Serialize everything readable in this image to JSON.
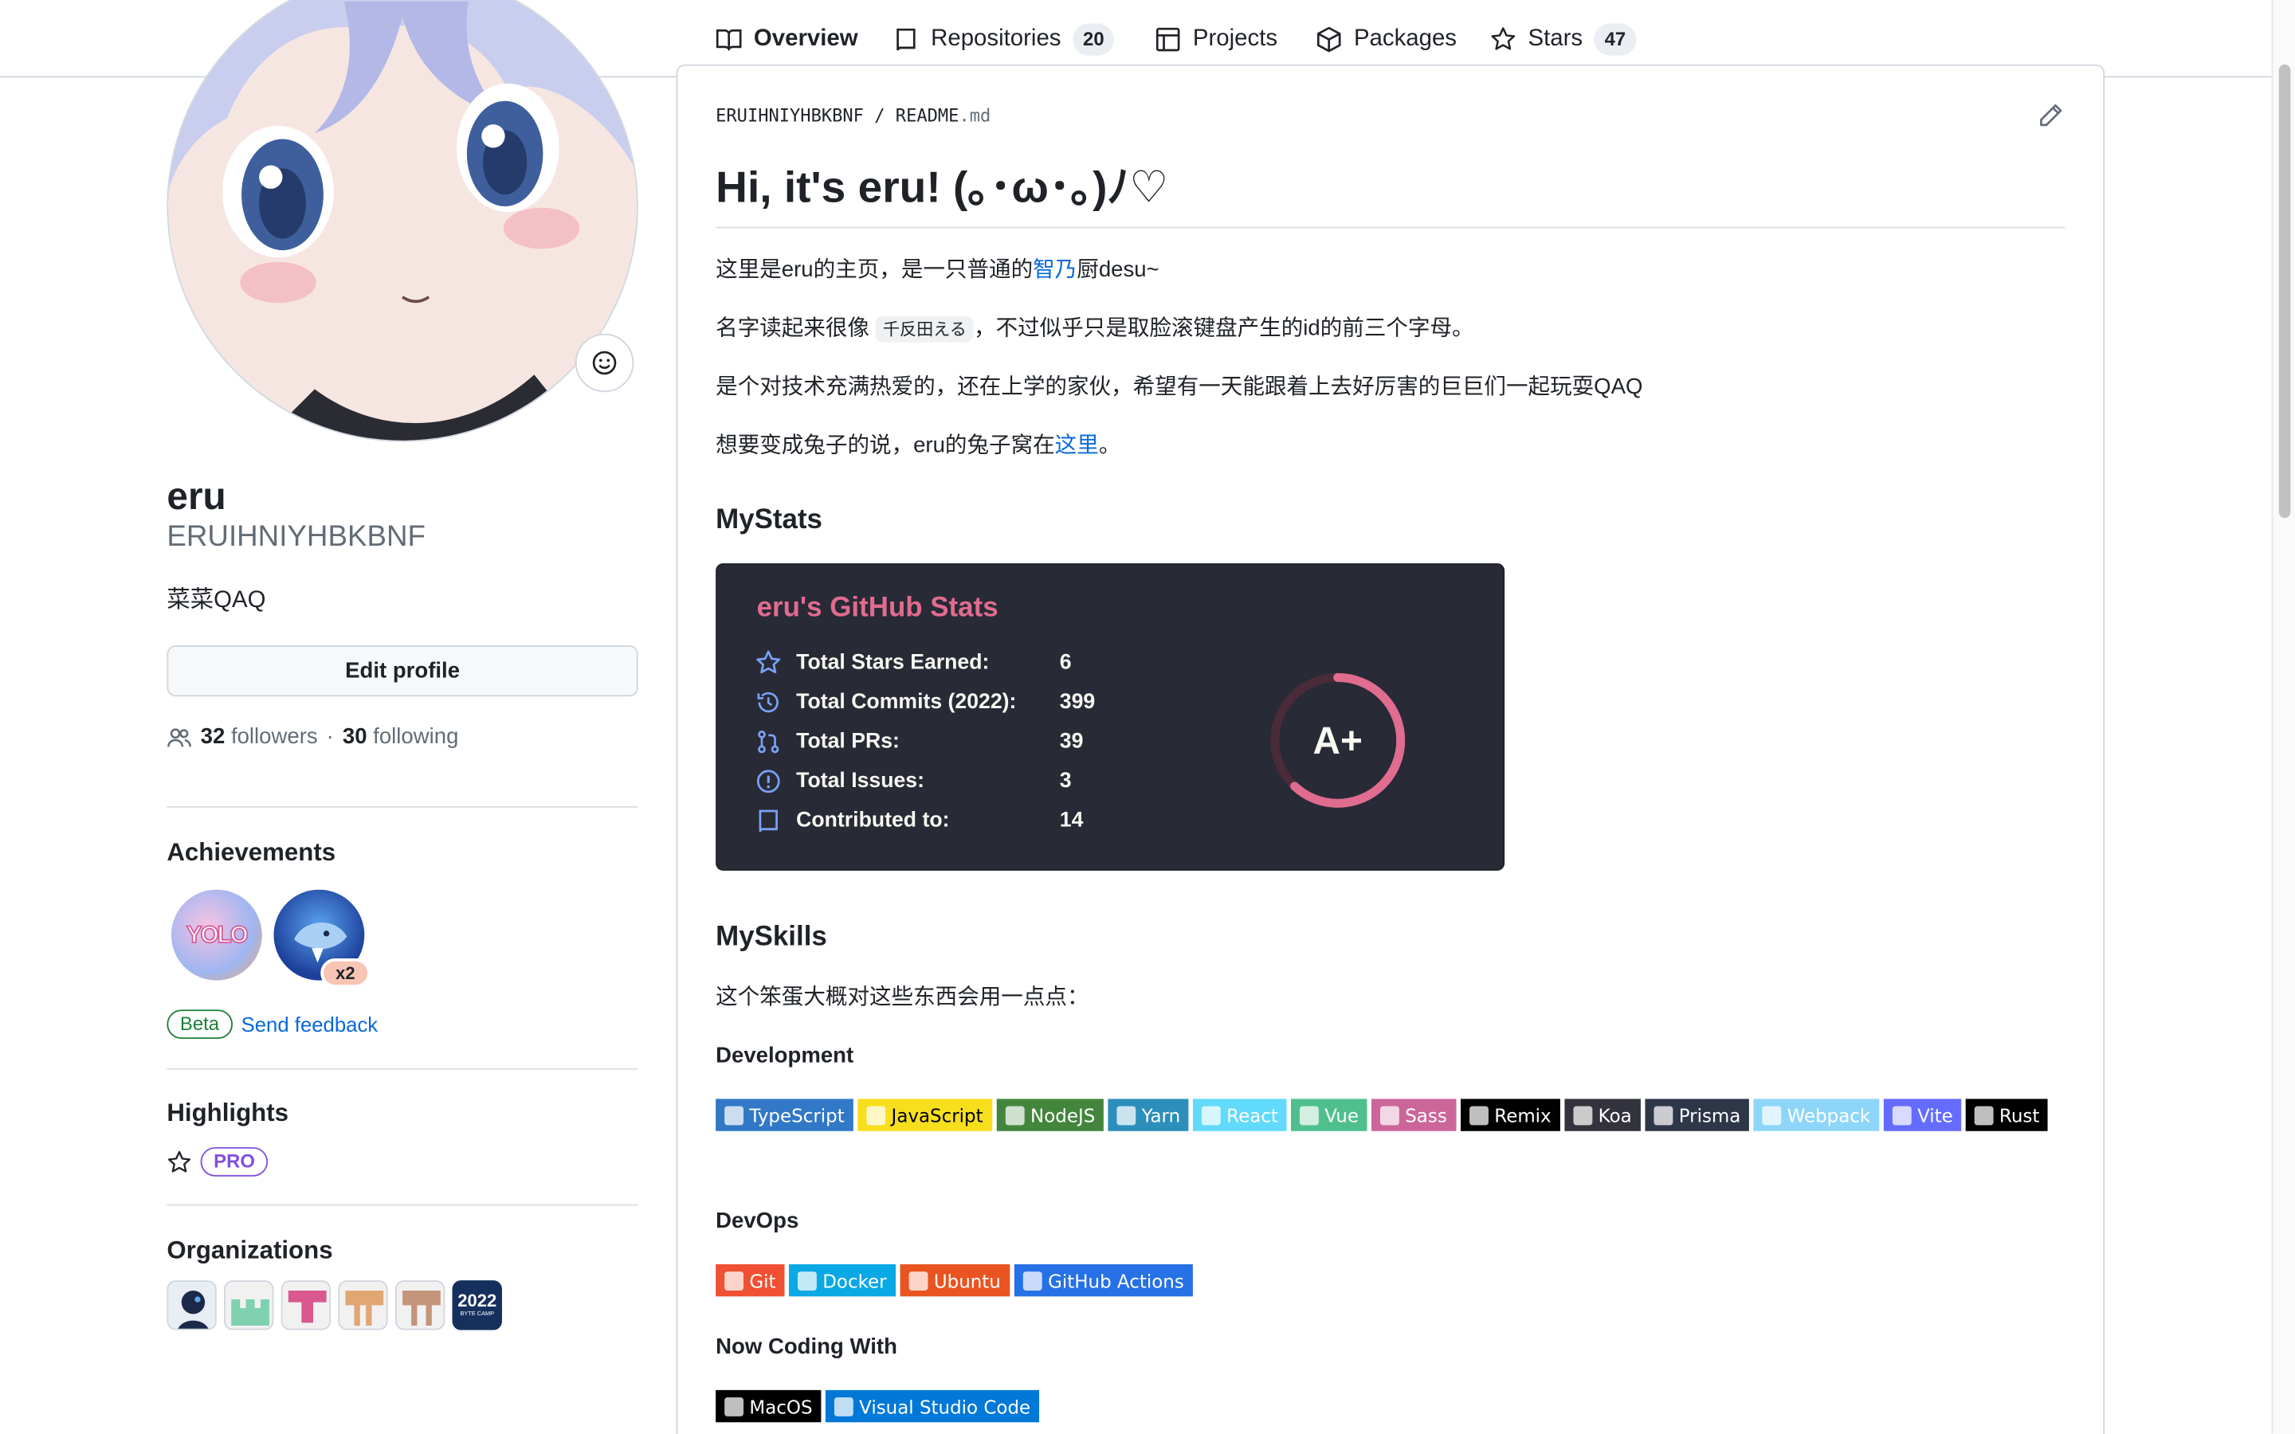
{
  "tabs": [
    {
      "label": "Overview",
      "count": null,
      "active": true
    },
    {
      "label": "Repositories",
      "count": "20"
    },
    {
      "label": "Projects",
      "count": null
    },
    {
      "label": "Packages",
      "count": null
    },
    {
      "label": "Stars",
      "count": "47"
    }
  ],
  "profile": {
    "name": "eru",
    "login": "ERUIHNIYHBKBNF",
    "bio": "菜菜QAQ",
    "edit_label": "Edit profile",
    "followers_count": "32",
    "followers_label": "followers",
    "separator": "·",
    "following_count": "30",
    "following_label": "following"
  },
  "achievements": {
    "title": "Achievements",
    "multiplier": "x2",
    "beta_label": "Beta",
    "feedback_label": "Send feedback"
  },
  "highlights": {
    "title": "Highlights",
    "pro_label": "PRO"
  },
  "organizations": {
    "title": "Organizations",
    "last_badge_text": "2022",
    "last_badge_sub": "BYTE CAMP"
  },
  "readme": {
    "breadcrumb_owner": "ERUIHNIYHBKBNF",
    "breadcrumb_sep": "/",
    "breadcrumb_file": "README",
    "breadcrumb_ext": ".md",
    "heading": "Hi, it's eru! (｡･ω･｡)ﾉ♡",
    "p1_a": "这里是eru的主页，是一只普通的",
    "p1_link": "智乃",
    "p1_b": "厨desu~",
    "p2_a": "名字读起来很像",
    "p2_code": "千反田える",
    "p2_b": "，不过似乎只是取脸滚键盘产生的id的前三个字母。",
    "p3": "是个对技术充满热爱的，还在上学的家伙，希望有一天能跟着上去好厉害的巨巨们一起玩耍QAQ",
    "p4_a": "想要变成兔子的说，eru的兔子窝在",
    "p4_link": "这里",
    "p4_b": "。",
    "mystats_title": "MyStats",
    "myskills_title": "MySkills",
    "skills_intro": "这个笨蛋大概对这些东西会用一点点：",
    "development_title": "Development",
    "devops_title": "DevOps",
    "coding_title": "Now Coding With"
  },
  "stats": {
    "title": "eru's GitHub Stats",
    "rows": [
      {
        "label": "Total Stars Earned:",
        "value": "6"
      },
      {
        "label": "Total Commits (2022):",
        "value": "399"
      },
      {
        "label": "Total PRs:",
        "value": "39"
      },
      {
        "label": "Total Issues:",
        "value": "3"
      },
      {
        "label": "Contributed to:",
        "value": "14"
      }
    ],
    "grade": "A+",
    "grade_progress": 0.62,
    "colors": {
      "title": "#e06c8f",
      "ring": "#e06c8f",
      "bg": "#282a36"
    }
  },
  "shields": {
    "development": [
      {
        "label": "TypeScript",
        "color": "#3178c6"
      },
      {
        "label": "JavaScript",
        "color": "#f7df1e",
        "text": "#000000"
      },
      {
        "label": "NodeJS",
        "color": "#43853d"
      },
      {
        "label": "Yarn",
        "color": "#2c8ebb"
      },
      {
        "label": "React",
        "color": "#61dafb"
      },
      {
        "label": "Vue",
        "color": "#4fc08d"
      },
      {
        "label": "Sass",
        "color": "#cc6699"
      },
      {
        "label": "Remix",
        "color": "#000000"
      },
      {
        "label": "Koa",
        "color": "#33333d"
      },
      {
        "label": "Prisma",
        "color": "#2d3748"
      },
      {
        "label": "Webpack",
        "color": "#8dd6f9"
      },
      {
        "label": "Vite",
        "color": "#646cff"
      },
      {
        "label": "Rust",
        "color": "#000000"
      }
    ],
    "devops": [
      {
        "label": "Git",
        "color": "#f05033"
      },
      {
        "label": "Docker",
        "color": "#0aa8e4"
      },
      {
        "label": "Ubuntu",
        "color": "#e95420"
      },
      {
        "label": "GitHub Actions",
        "color": "#2671e5"
      }
    ],
    "coding": [
      {
        "label": "MacOS",
        "color": "#000000"
      },
      {
        "label": "Visual Studio Code",
        "color": "#0078d7"
      }
    ]
  }
}
